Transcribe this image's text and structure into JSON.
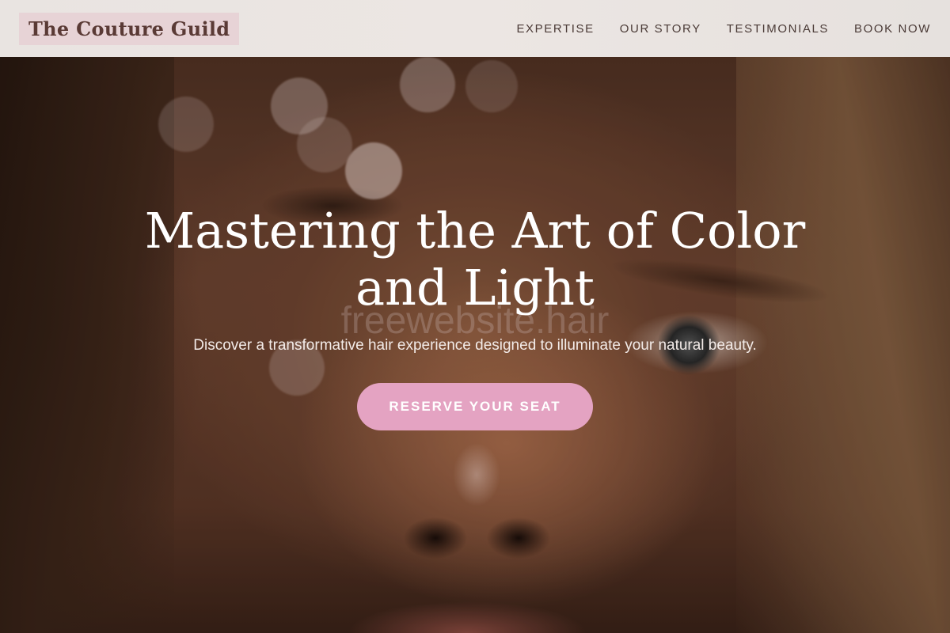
{
  "header": {
    "logo": "The Couture Guild",
    "nav": [
      {
        "label": "EXPERTISE"
      },
      {
        "label": "OUR STORY"
      },
      {
        "label": "TESTIMONIALS"
      },
      {
        "label": "BOOK NOW"
      }
    ]
  },
  "hero": {
    "headline_line1": "Mastering the Art of Color",
    "headline_line2": "and Light",
    "subtext": "Discover a transformative hair experience designed to illuminate your natural beauty.",
    "cta_label": "RESERVE YOUR SEAT",
    "watermark": "freewebsite.hair"
  },
  "colors": {
    "accent": "#e4a3c2",
    "logo_bg": "#e7d3d6",
    "logo_text": "#5a3a35",
    "nav_bg": "#ebe6e3"
  }
}
